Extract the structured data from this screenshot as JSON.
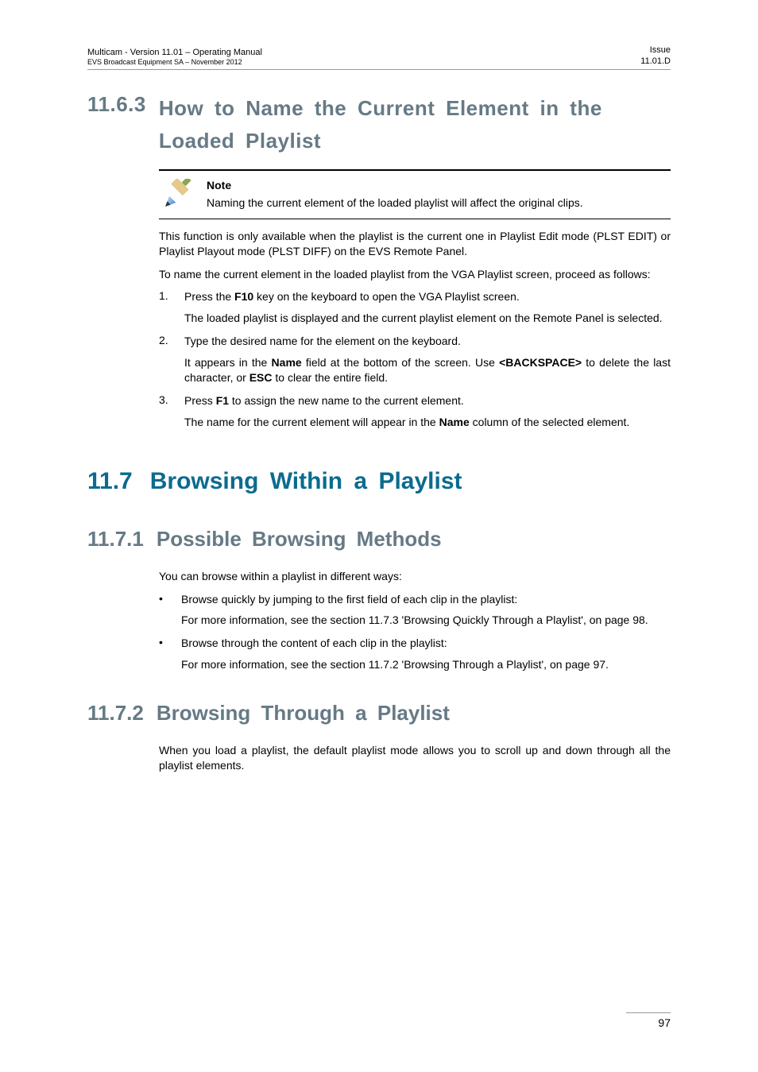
{
  "header": {
    "left_line1": "Multicam - Version 11.01 – Operating Manual",
    "left_line2": "EVS Broadcast Equipment SA – November 2012",
    "right_line1": "Issue",
    "right_line2": "11.01.D"
  },
  "s1": {
    "num": "11.6.3",
    "title": "How to Name the Current Element in the Loaded Playlist",
    "note_label": "Note",
    "note_text": "Naming the current element of the loaded playlist will affect the original clips.",
    "p1": "This function is only available when the playlist is the current one in Playlist Edit mode (PLST EDIT) or Playlist Playout mode (PLST DIFF) on the EVS Remote Panel.",
    "p2": "To name the current element in the loaded playlist from the VGA Playlist screen, proceed as follows:",
    "step1_a": "Press the ",
    "step1_b": "F10",
    "step1_c": " key on the keyboard to open the VGA Playlist screen.",
    "step1_sub": "The loaded playlist is displayed and the current playlist element on the Remote Panel is selected.",
    "step2": "Type the desired name for the element on the keyboard.",
    "step2_sub_a": "It appears in the ",
    "step2_sub_b": "Name",
    "step2_sub_c": " field at the bottom of the screen. Use ",
    "step2_sub_d": "<BACKSPACE>",
    "step2_sub_e": " to delete the last character, or ",
    "step2_sub_f": "ESC",
    "step2_sub_g": " to clear the entire field.",
    "step3_a": "Press ",
    "step3_b": "F1",
    "step3_c": " to assign the new name to the current element.",
    "step3_sub_a": "The name for the current element will appear in the ",
    "step3_sub_b": "Name",
    "step3_sub_c": " column of the selected element."
  },
  "s2": {
    "num": "11.7",
    "title": "Browsing Within a Playlist"
  },
  "s3": {
    "num": "11.7.1",
    "title": "Possible Browsing Methods",
    "p1": "You can browse within a playlist in different ways:",
    "b1": "Browse quickly by jumping to the first field of each clip in the playlist:",
    "b1_sub": "For more information, see the section 11.7.3 'Browsing Quickly Through a Playlist', on page 98.",
    "b2": "Browse through the content of each clip in the playlist:",
    "b2_sub": "For more information, see the section 11.7.2 'Browsing Through a Playlist', on page 97."
  },
  "s4": {
    "num": "11.7.2",
    "title": "Browsing Through a Playlist",
    "p1": "When you load a playlist, the default playlist mode allows you to scroll up and down through all the playlist elements."
  },
  "footer": {
    "page": "97"
  }
}
